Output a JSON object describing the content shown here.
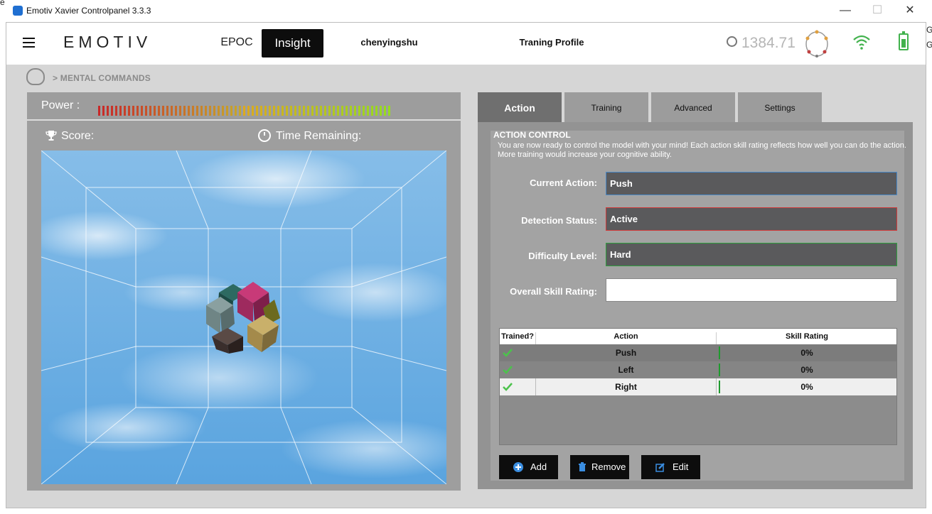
{
  "window": {
    "title": "Emotiv Xavier Controlpanel 3.3.3",
    "minimize": "—",
    "maximize": "☐",
    "close": "✕"
  },
  "header": {
    "logo": "EMOTIV",
    "devices": [
      "EPOC",
      "Insight"
    ],
    "selected_device": "Insight",
    "user": "chenyingshu",
    "profile": "Traning Profile",
    "timer": "1384.71"
  },
  "breadcrumb": "> MENTAL COMMANDS",
  "game": {
    "power_label": "Power :",
    "power_level": 1.0,
    "score_label": "Score:",
    "time_label": "Time Remaining:"
  },
  "tabs": [
    "Action",
    "Training",
    "Advanced",
    "Settings"
  ],
  "active_tab": "Action",
  "action_control": {
    "title": "ACTION CONTROL",
    "description": "You are now ready to control the model with your mind! Each action skill rating reflects how well you can do the action. More training would increase your cognitive ability.",
    "fields": {
      "current_action": {
        "label": "Current Action:",
        "value": "Push"
      },
      "detection_status": {
        "label": "Detection Status:",
        "value": "Active"
      },
      "difficulty": {
        "label": "Difficulty Level:",
        "value": "Hard"
      },
      "overall_skill": {
        "label": "Overall Skill Rating:",
        "value": ""
      }
    }
  },
  "table": {
    "headers": [
      "Trained?",
      "Action",
      "Skill Rating"
    ],
    "rows": [
      {
        "trained": true,
        "action": "Push",
        "rating": "0%"
      },
      {
        "trained": true,
        "action": "Left",
        "rating": "0%"
      },
      {
        "trained": true,
        "action": "Right",
        "rating": "0%"
      }
    ]
  },
  "buttons": {
    "add": "Add",
    "remove": "Remove",
    "edit": "Edit"
  },
  "colors": {
    "accent_green": "#42b24d",
    "status_red": "#d13a3a",
    "action_blue": "#4a8ac9"
  }
}
